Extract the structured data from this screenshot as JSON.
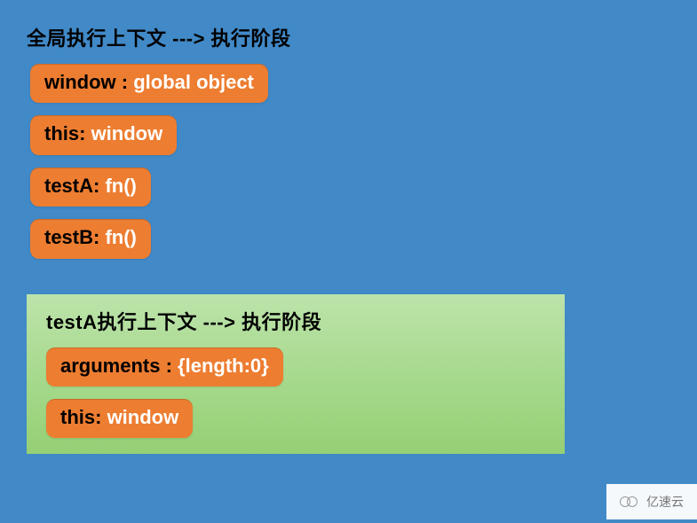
{
  "global": {
    "title": "全局执行上下文 ---> 执行阶段",
    "entries": [
      {
        "label": "window : ",
        "value": "global object"
      },
      {
        "label": "this: ",
        "value": "window"
      },
      {
        "label": "testA: ",
        "value": "fn()"
      },
      {
        "label": "testB: ",
        "value": "fn()"
      }
    ]
  },
  "nested": {
    "title_prefix": "testA",
    "title_rest": "执行上下文 ---> 执行阶段",
    "entries": [
      {
        "label": "arguments : ",
        "value": "{length:0}"
      },
      {
        "label": "this: ",
        "value": "window"
      }
    ]
  },
  "watermark": "亿速云"
}
